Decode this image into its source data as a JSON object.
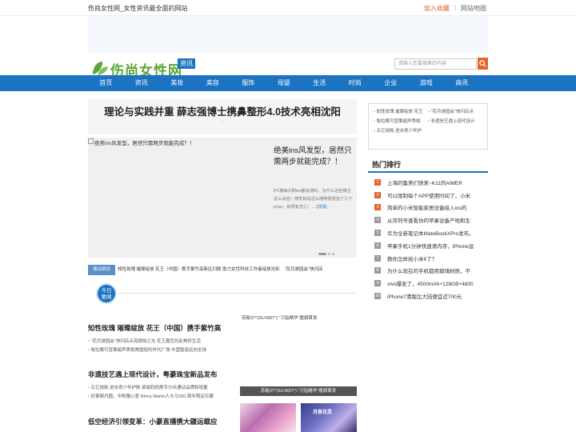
{
  "header": {
    "slogan": "伤尚女性网_女性资讯最全面的网站",
    "fav_label": "加入收藏",
    "sep": "|",
    "sitemap_label": "网站地图"
  },
  "logo": {
    "text": "伤尚女性网",
    "tag": "资讯"
  },
  "search": {
    "placeholder": "请输入您要搜索的内容"
  },
  "nav": [
    "首页",
    "资讯",
    "美妆",
    "美容",
    "服饰",
    "母婴",
    "生活",
    "时尚",
    "企业",
    "游戏",
    "商讯"
  ],
  "headline": {
    "title": "理论与实践并重 薛志强博士携鼻整形4.0技术亮相沈阳",
    "more": ".."
  },
  "slider": {
    "image_alt": "绝美ins风发型，居然只需两步就能完成？！",
    "title": "绝美ins风发型，居然只需两步就能完成？！",
    "desc": "PC酱每次刷ins都会感叹，为什么这些博主这么会拍！感觉就是这么随随便便拍了几个pose，就很有范儿！...",
    "more_label": "[详情]"
  },
  "scroll_news": {
    "label": "滚动资讯",
    "items": [
      "知性玫瑰 璀璨绽放 花王（中国）携手紫竹高新区扫联 助力女性科技工作者绽放光彩",
      "\"花月游园会\"快闪店"
    ]
  },
  "today": {
    "line1": "今日",
    "line2": "要闻"
  },
  "groups": [
    {
      "title": "知性玫瑰 璀璨绽放 花王（中国）携手紫竹高",
      "items": [
        "\"花月游园会\"快闪店点亮顺徐之光 花王嘉您共赴美好生活",
        "梨拉案可宣筹超声秀相美国纽约时代广场 中国智造远向全球"
      ]
    },
    {
      "title": "非遗技艺遇上现代设计，粤豪珠宝新品发布",
      "items": [
        "五亿烧耗 进击青少年护肤 袋鼠妈妈携手分众通动品牌新增量",
        "好事随月圆，中秋赠心意 Rémy Martin人头马300 周年限定珍藏"
      ]
    },
    {
      "title": "低空经济引领变革：小豪直播携大疆运载应",
      "items": []
    }
  ],
  "pictures": {
    "caption_top": "苏秘37°(SU:M37°) \"刁钻精华\"震撼首发",
    "caption_bar": "苏秘37°(SU:M37°) \"刁钻精华\"震撼首发",
    "thumb2_label": "月荟花灵"
  },
  "side_links": [
    "知性玫瑰 璀璨绽放 花王",
    "\"花月游园会\"快闪店点",
    "梨拉案可宣筹超声秀相",
    "非遗技艺遇上现代设计",
    "五亿烧耗 进击青少年护"
  ],
  "hot": {
    "title": "热门排行",
    "items": [
      {
        "num": "1",
        "text": "上海的集美们快来~K11的AIMER"
      },
      {
        "num": "2",
        "text": "可以限制每个APP使用时间了，小米"
      },
      {
        "num": "3",
        "text": "简单的小米智能家居设备接入ios的"
      },
      {
        "num": "4",
        "text": "从序列号查看你的苹果设备产地和生"
      },
      {
        "num": "5",
        "text": "华为全新笔记本MateBookXPro发布，"
      },
      {
        "num": "6",
        "text": "苹果手机1分钟快速清内存，iPhone运"
      },
      {
        "num": "7",
        "text": "教你怎样抢小米6了？"
      },
      {
        "num": "8",
        "text": "为什么现在的手机都用玻璃材质，不"
      },
      {
        "num": "9",
        "text": "vivo爆发了，4500mAh+128GB+4800"
      },
      {
        "num": "10",
        "text": "iPhone7港版比大陆便宜近700元"
      }
    ]
  }
}
